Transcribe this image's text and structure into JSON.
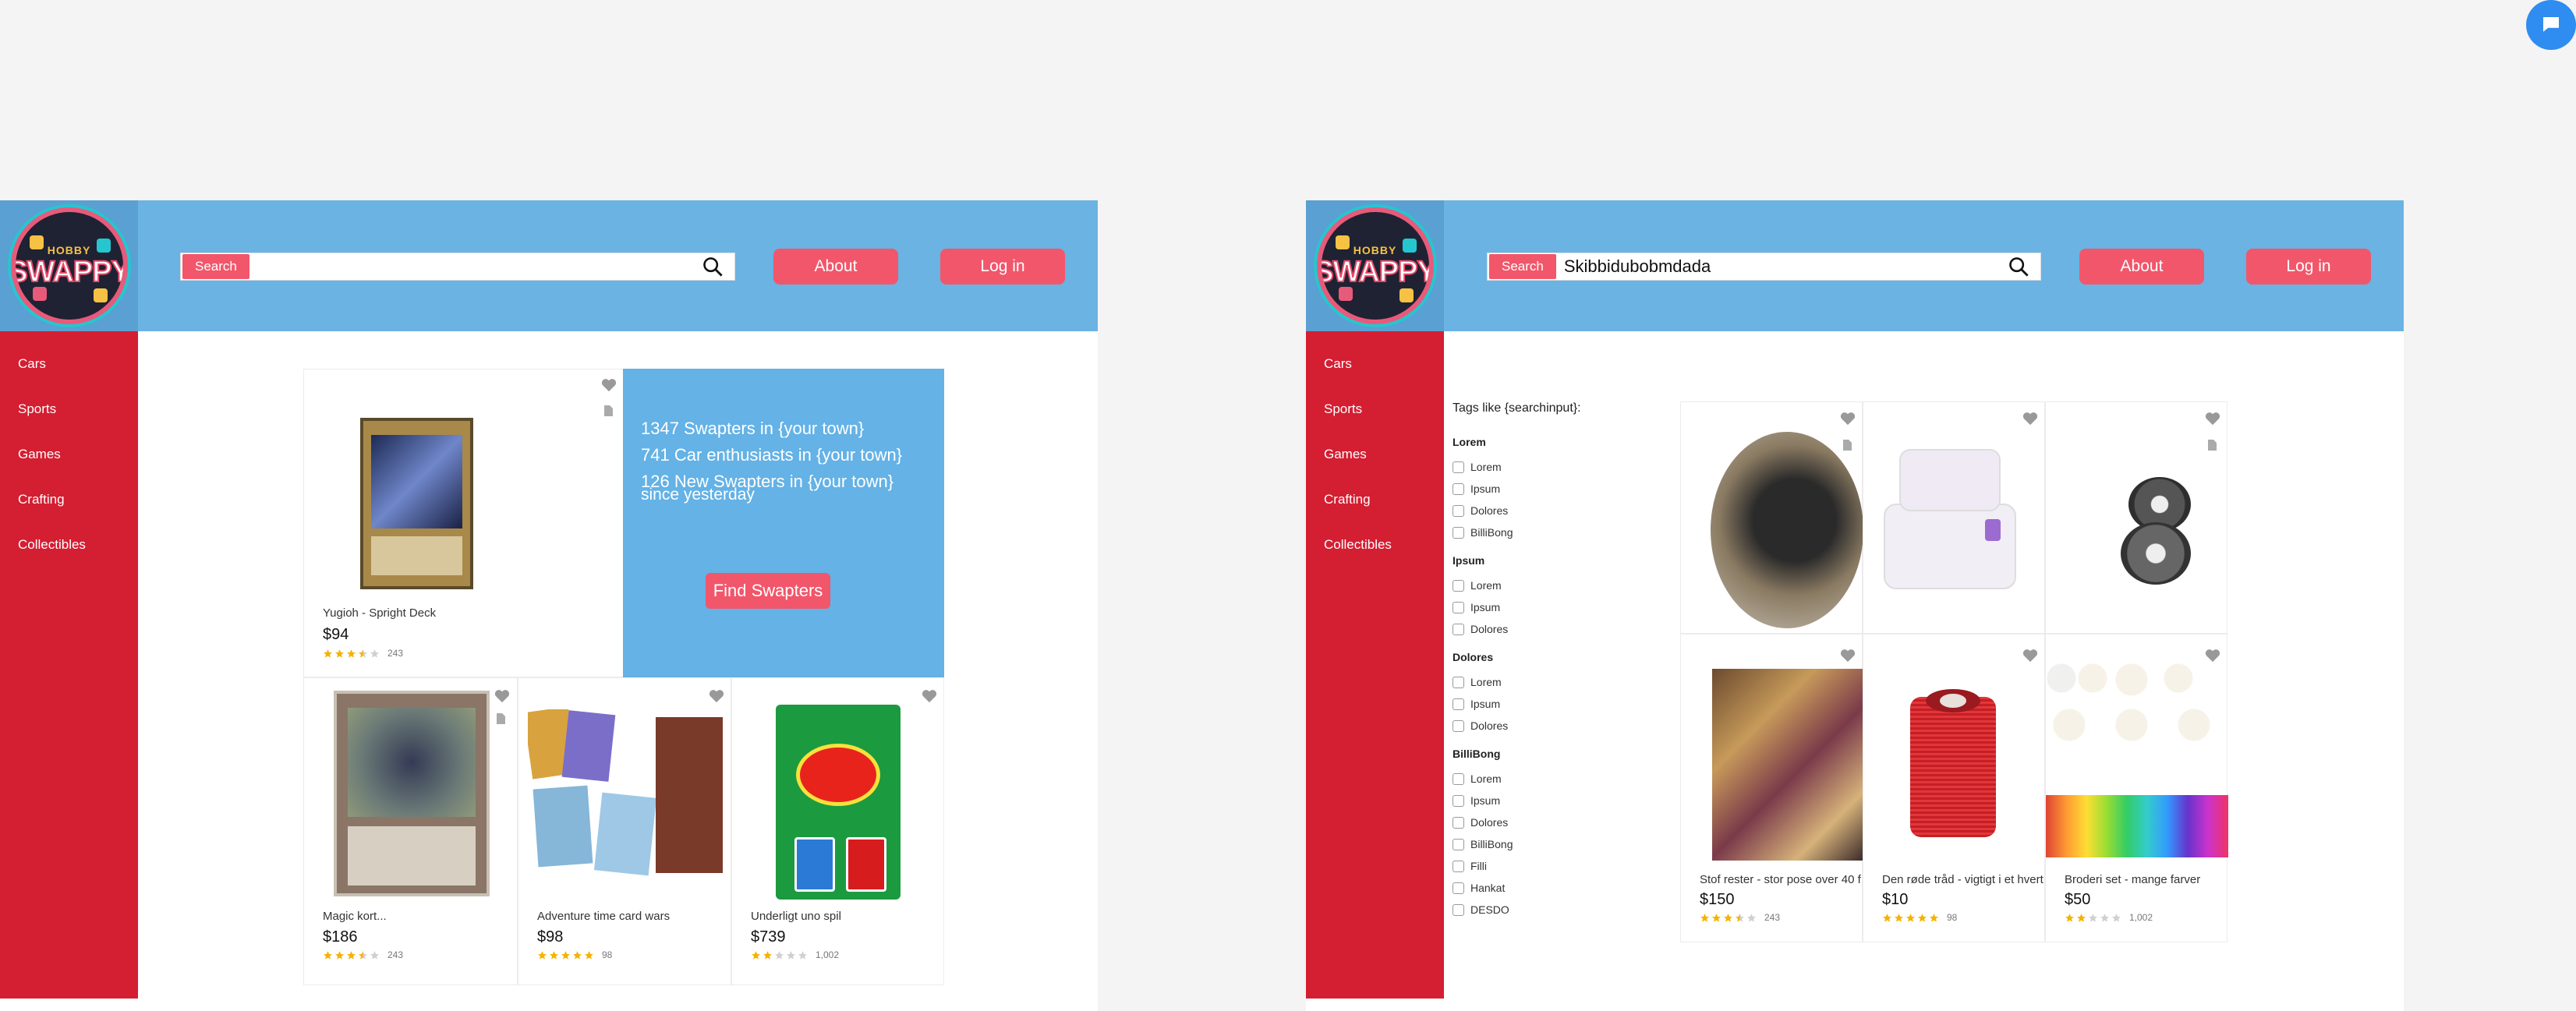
{
  "brand": {
    "small": "HOBBY",
    "name": "SWAPPY"
  },
  "colors": {
    "header": "#6ab3e3",
    "sidebar": "#d41e32",
    "accent": "#f2566a",
    "promo": "#64b2e6",
    "star": "#f5b301"
  },
  "nav": {
    "search_label": "Search",
    "about": "About",
    "login": "Log in"
  },
  "categories": [
    "Cars",
    "Sports",
    "Games",
    "Crafting",
    "Collectibles"
  ],
  "home": {
    "search_value": "",
    "promo": {
      "lines": [
        "1347 Swapters in {your town}",
        "741 Car enthusiasts in {your town}",
        "126 New Swapters in {your town}",
        "since yesterday"
      ],
      "button": "Find Swapters"
    },
    "products": [
      {
        "title": "Yugioh - Spright Deck",
        "price": "$94",
        "rating": 3.5,
        "count": "243"
      },
      {
        "title": "Magic kort...",
        "price": "$186",
        "rating": 3.5,
        "count": "243"
      },
      {
        "title": "Adventure time card wars",
        "price": "$98",
        "rating": 5,
        "count": "98"
      },
      {
        "title": "Underligt uno spil",
        "price": "$739",
        "rating": 2,
        "count": "1,002"
      }
    ]
  },
  "results": {
    "search_value": "Skibbidubobmdada",
    "filters": {
      "heading": "Tags like {searchinput}:",
      "groups": [
        {
          "title": "Lorem",
          "options": [
            "Lorem",
            "Ipsum",
            "Dolores",
            "BilliBong"
          ]
        },
        {
          "title": "Ipsum",
          "options": [
            "Lorem",
            "Ipsum",
            "Dolores"
          ]
        },
        {
          "title": "Dolores",
          "options": [
            "Lorem",
            "Ipsum",
            "Dolores"
          ]
        },
        {
          "title": "BilliBong",
          "options": [
            "Lorem",
            "Ipsum",
            "Dolores",
            "BilliBong",
            "Filli",
            "Hankat",
            "DESDO"
          ]
        }
      ]
    },
    "products": [
      {
        "title": "Stof rester - stor pose over 40 f",
        "price": "$150",
        "rating": 3.5,
        "count": "243"
      },
      {
        "title": "Den røde tråd - vigtigt i et hvert",
        "price": "$10",
        "rating": 5,
        "count": "98"
      },
      {
        "title": "Broderi set - mange farver",
        "price": "$50",
        "rating": 2,
        "count": "1,002"
      }
    ]
  }
}
